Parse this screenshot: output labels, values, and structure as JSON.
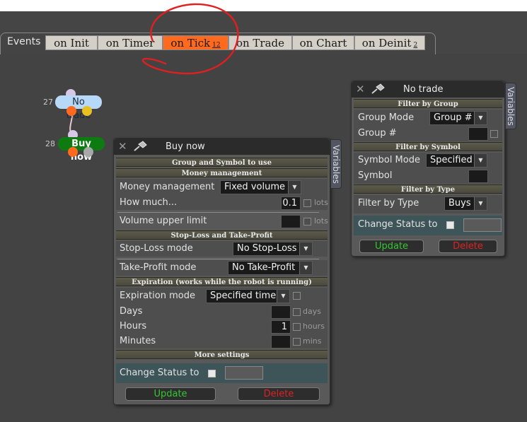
{
  "events_label": "Events",
  "tabs": [
    {
      "label": "on Init",
      "badge": ""
    },
    {
      "label": "on Timer",
      "badge": ""
    },
    {
      "label": "on Tick",
      "badge": "12"
    },
    {
      "label": "on Trade",
      "badge": ""
    },
    {
      "label": "on Chart",
      "badge": ""
    },
    {
      "label": "on Deinit",
      "badge": "2"
    }
  ],
  "active_tab": "on Tick",
  "nodes": [
    {
      "number": "27",
      "label": "No trade",
      "color": "#b8d8f8"
    },
    {
      "number": "28",
      "label": "Buy now",
      "color": "#0e7a12"
    }
  ],
  "colors": {
    "active_tab": "#ff6a1f",
    "annotation": "#e02020",
    "update_text": "#32c832",
    "delete_text": "#dd2222",
    "status_row": "#3d5458"
  },
  "buy_panel": {
    "title": "Buy now",
    "side_tab": "Variables",
    "close_icon": "✕",
    "sections": {
      "group_symbol": "Group and Symbol to use",
      "money": "Money management",
      "sl_tp": "Stop-Loss and Take-Profit",
      "expiration": "Expiration (works while the robot is running)",
      "more": "More settings"
    },
    "money_management": {
      "label": "Money management",
      "value": "Fixed volume"
    },
    "how_much": {
      "label": "How much...",
      "value": "0.1",
      "unit": "lots"
    },
    "volume_upper_limit": {
      "label": "Volume upper limit",
      "value": "",
      "unit": "lots"
    },
    "stop_loss_mode": {
      "label": "Stop-Loss mode",
      "value": "No Stop-Loss"
    },
    "take_profit_mode": {
      "label": "Take-Profit mode",
      "value": "No Take-Profit"
    },
    "expiration_mode": {
      "label": "Expiration mode",
      "value": "Specified time"
    },
    "days": {
      "label": "Days",
      "value": "",
      "unit": "days"
    },
    "hours": {
      "label": "Hours",
      "value": "1",
      "unit": "hours"
    },
    "minutes": {
      "label": "Minutes",
      "value": "",
      "unit": "mins"
    },
    "change_status": {
      "label": "Change Status to",
      "value": ""
    },
    "update_label": "Update",
    "delete_label": "Delete"
  },
  "notrade_panel": {
    "title": "No trade",
    "side_tab": "Variables",
    "close_icon": "✕",
    "sections": {
      "group": "Filter by Group",
      "symbol": "Filter by Symbol",
      "type": "Filter by Type"
    },
    "group_mode": {
      "label": "Group Mode",
      "value": "Group #"
    },
    "group_num": {
      "label": "Group #",
      "value": ""
    },
    "symbol_mode": {
      "label": "Symbol Mode",
      "value": "Specified"
    },
    "symbol": {
      "label": "Symbol",
      "value": ""
    },
    "filter_by_type": {
      "label": "Filter by Type",
      "value": "Buys"
    },
    "change_status": {
      "label": "Change Status to",
      "value": ""
    },
    "update_label": "Update",
    "delete_label": "Delete"
  }
}
